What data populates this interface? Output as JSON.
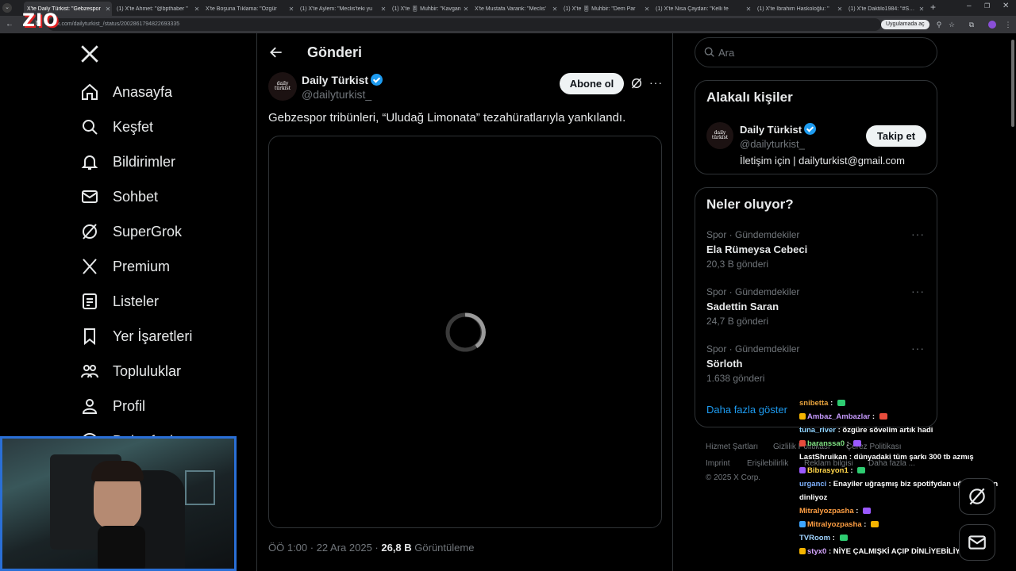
{
  "browser": {
    "tabs": [
      {
        "title": "X'te Daily Türkist: \"Gebzespor",
        "active": true
      },
      {
        "title": "(1) X'te Ahmet: \"@bpthaber \"",
        "active": false
      },
      {
        "title": "X'te Boşuna Tıklama: \"Özgür",
        "active": false
      },
      {
        "title": "(1) X'te Aylem: \"Meclis'teki yu",
        "active": false
      },
      {
        "title": "(1) X'te 🎚 Muhbir: \"Kavgan",
        "active": false
      },
      {
        "title": "X'te Mustafa Varank: \"Meclis'",
        "active": false
      },
      {
        "title": "(1) X'te 🎚 Muhbir: \"Dem Par",
        "active": false
      },
      {
        "title": "(1) X'te Nisa Çaydan: \"Kelli fe",
        "active": false
      },
      {
        "title": "(1) X'te İbrahim Haskoloğlu: \"",
        "active": false
      },
      {
        "title": "(1) X'te Daktilo1984: \"#SONDAK",
        "active": false
      }
    ],
    "url": "x.com/dailyturkist_/status/2002861794822693335",
    "app_button": "Uygulamada aç",
    "stream_logo": "ZIO"
  },
  "nav": {
    "items": [
      {
        "label": "Anasayfa",
        "icon": "home-icon"
      },
      {
        "label": "Keşfet",
        "icon": "search-icon"
      },
      {
        "label": "Bildirimler",
        "icon": "bell-icon"
      },
      {
        "label": "Sohbet",
        "icon": "mail-icon"
      },
      {
        "label": "SuperGrok",
        "icon": "grok-icon"
      },
      {
        "label": "Premium",
        "icon": "x-logo-icon"
      },
      {
        "label": "Listeler",
        "icon": "list-icon"
      },
      {
        "label": "Yer İşaretleri",
        "icon": "bookmark-icon"
      },
      {
        "label": "Topluluklar",
        "icon": "communities-icon"
      },
      {
        "label": "Profil",
        "icon": "profile-icon"
      },
      {
        "label": "Daha fazla",
        "icon": "more-circle-icon"
      }
    ]
  },
  "post": {
    "header_title": "Gönderi",
    "author_name": "Daily Türkist",
    "author_handle": "@dailyturkist_",
    "avatar_text": "daily türkist",
    "subscribe_label": "Abone ol",
    "text": "Gebzespor tribünleri, “Uludağ Limonata” tezahüratlarıyla yankılandı.",
    "timestamp": "ÖÖ 1:00 · 22 Ara 2025 · ",
    "views_count": "26,8 B",
    "views_label": " Görüntüleme"
  },
  "search": {
    "placeholder": "Ara"
  },
  "related": {
    "title": "Alakalı kişiler",
    "name": "Daily Türkist",
    "handle": "@dailyturkist_",
    "bio": "İletişim için | dailyturkist@gmail.com",
    "follow_label": "Takip et"
  },
  "trends": {
    "title": "Neler oluyor?",
    "items": [
      {
        "meta": "Spor · Gündemdekiler",
        "title": "Ela Rümeysa Cebeci",
        "count": "20,3 B gönderi"
      },
      {
        "meta": "Spor · Gündemdekiler",
        "title": "Sadettin Saran",
        "count": "24,7 B gönderi"
      },
      {
        "meta": "Spor · Gündemdekiler",
        "title": "Sörloth",
        "count": "1.638 gönderi"
      }
    ],
    "show_more": "Daha fazla göster"
  },
  "footer": {
    "links": [
      "Hizmet Şartları",
      "Gizlilik Politikası",
      "Çerez Politikası",
      "Imprint",
      "Erişilebilirlik",
      "Reklam bilgisi",
      "Daha fazla ..."
    ],
    "copyright": "© 2025 X Corp."
  },
  "chat": [
    {
      "user": "snibetta",
      "color": "#e8a33d",
      "message": ""
    },
    {
      "user": "Ambaz_Ambazlar",
      "color": "#c79bff",
      "message": ""
    },
    {
      "user": "tuna_river",
      "color": "#8fd3ff",
      "message": "özgüre sövelim artık hadi"
    },
    {
      "user": "baranssa0",
      "color": "#7ee081",
      "message": ""
    },
    {
      "user": "LastShruikan",
      "color": "#ffffff",
      "message": "dünyadaki tüm şarkı 300 tb azmış"
    },
    {
      "user": "Bibrasyon1",
      "color": "#ffd54a",
      "message": ""
    },
    {
      "user": "urganci",
      "color": "#7fb2ff",
      "message": "Enayiler uğraşmış biz spotifydan uğraşmadan"
    },
    {
      "user": "",
      "color": "#ffffff",
      "message": "dinliyoz"
    },
    {
      "user": "Mitralyozpasha",
      "color": "#ff9f43",
      "message": ""
    },
    {
      "user": "Mitralyozpasha",
      "color": "#ff9f43",
      "message": ""
    },
    {
      "user": "TVRoom",
      "color": "#9fd3ff",
      "message": ""
    },
    {
      "user": "styx0",
      "color": "#d7a6ff",
      "message": "NİYE ÇALMIŞKİ AÇIP DİNLİYEBİLİYOZ İŞTE"
    }
  ],
  "colors": {
    "accent": "#1d9bf0",
    "background": "#000000",
    "border": "#2f3336",
    "muted": "#71767b",
    "webcam_border": "#2a6fd6"
  }
}
